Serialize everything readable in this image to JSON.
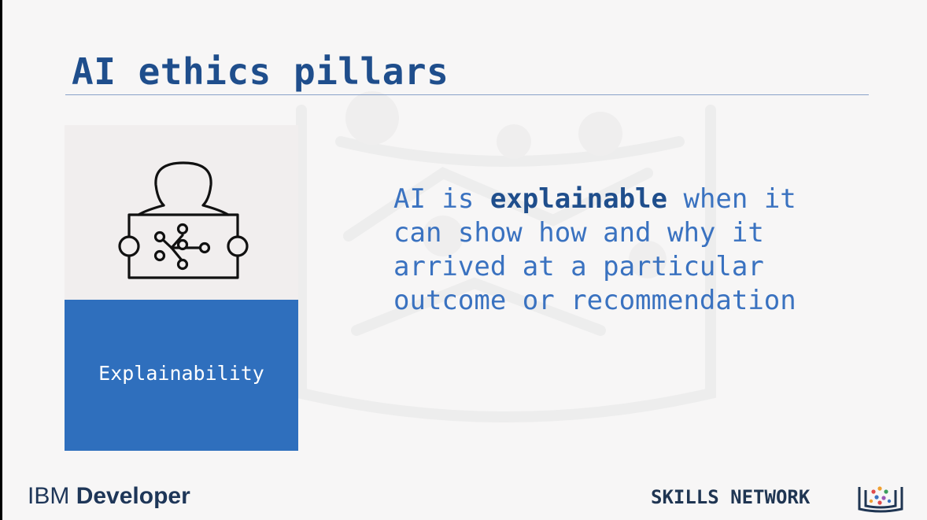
{
  "slide": {
    "title": "AI ethics pillars",
    "pillar": {
      "label": "Explainability",
      "icon": "person-with-network-board-icon"
    },
    "description": {
      "pre": "AI is ",
      "keyword": "explainable",
      "post": " when it can show how and why it arrived at a particular outcome or recommendation"
    }
  },
  "footer": {
    "brand_first": "IBM",
    "brand_second": "Developer",
    "network_label": "SKILLS NETWORK",
    "network_icon": "skills-network-book-icon"
  },
  "colors": {
    "title": "#1f4e8c",
    "description": "#3a72c0",
    "card_blue": "#2f6fbd",
    "card_grey": "#f1eeee",
    "background": "#f7f6f6"
  }
}
